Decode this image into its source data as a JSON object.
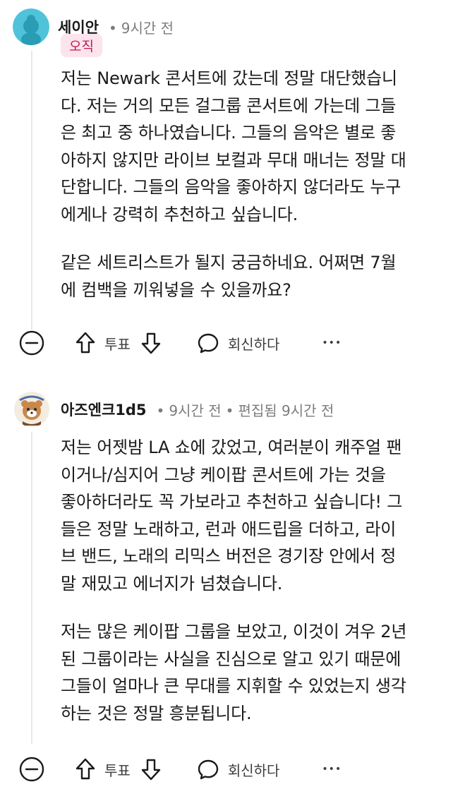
{
  "comments": [
    {
      "username": "세이안",
      "time": "9시간 전",
      "flair": "오직",
      "paragraphs": [
        "저는 Newark 콘서트에 갔는데 정말 대단했습니\n다. 저는 거의 모든 걸그룹 콘서트에 가는데 그들\n은 최고 중 하나였습니다. 그들의 음악은 별로 좋\n아하지 않지만 라이브 보컬과 무대 매너는 정말 대\n단합니다. 그들의 음악을 좋아하지 않더라도 누구\n에게나 강력히 추천하고 싶습니다.",
        "같은 세트리스트가 될지 궁금하네요. 어쩌면 7월\n에 컴백을 끼워넣을 수 있을까요?"
      ],
      "vote_label": "투표",
      "reply_label": "회신하다",
      "more": "•••"
    },
    {
      "username": "아즈엔크1d5",
      "time": "9시간 전",
      "edited": "편집됨 9시간 전",
      "paragraphs": [
        "저는 어젯밤 LA 쇼에 갔었고, 여러분이 캐주얼 팬\n이거나/심지어 그냥 케이팝 콘서트에 가는 것을\n좋아하더라도 꼭 가보라고 추천하고 싶습니다! 그\n들은 정말 노래하고, 런과 애드립을 더하고, 라이\n브 밴드, 노래의 리믹스 버전은 경기장 안에서 정\n말 재밌고 에너지가 넘쳤습니다.",
        "저는 많은 케이팝 그룹을 보았고, 이것이 겨우 2년\n된 그룹이라는 사실을 진심으로 알고 있기 때문에\n그들이 얼마나 큰 무대를 지휘할 수 있었는지 생각\n하는 것은 정말 흥분됩니다."
      ],
      "vote_label": "투표",
      "reply_label": "회신하다",
      "more": "•••"
    }
  ],
  "colors": {
    "avatar1_bg": "#4fc3d9",
    "flair_bg": "#fce4ec",
    "flair_text": "#c2185b",
    "thread_line": "#e5e9eb",
    "meta_text": "#7c7c7c"
  },
  "icons": [
    "collapse-icon",
    "upvote-icon",
    "downvote-icon",
    "reply-icon",
    "more-icon",
    "avatar-icon"
  ]
}
